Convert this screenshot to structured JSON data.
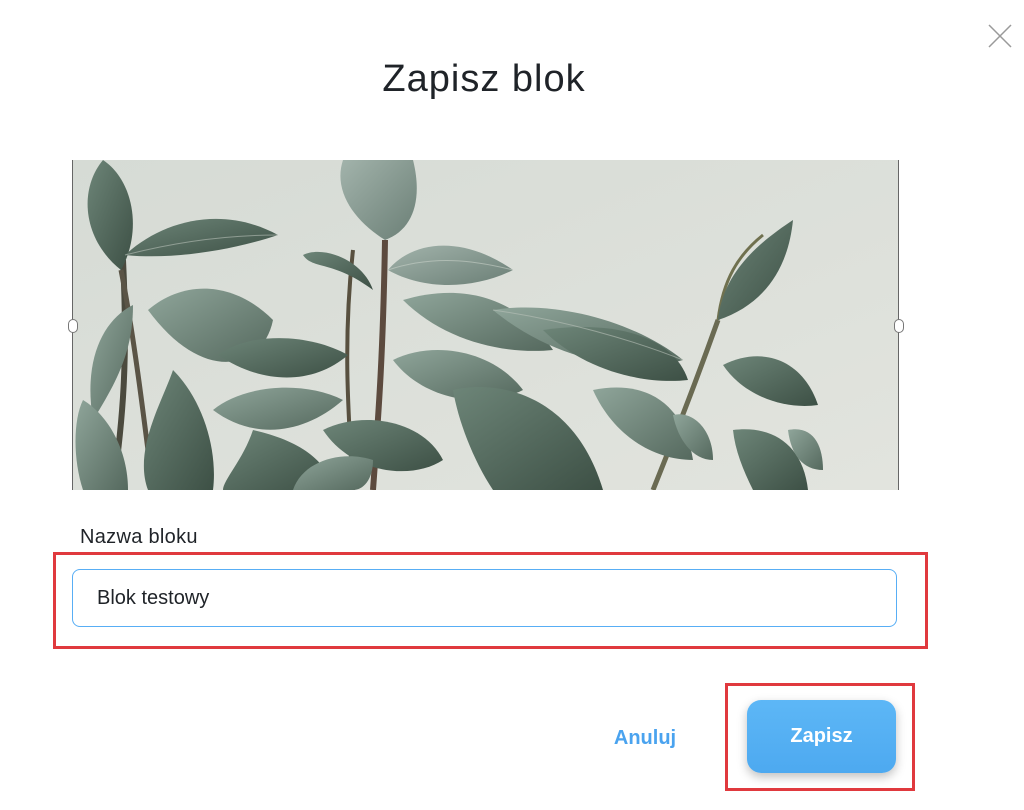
{
  "dialog": {
    "title": "Zapisz blok",
    "close_icon": "close-icon"
  },
  "preview": {
    "image_subject": "plant-leaves-image",
    "background_color": "#dcdfda"
  },
  "form": {
    "name_label": "Nazwa bloku",
    "name_value": "Blok testowy",
    "name_placeholder": ""
  },
  "actions": {
    "cancel_label": "Anuluj",
    "save_label": "Zapisz"
  },
  "colors": {
    "accent": "#4aa3ef",
    "highlight": "#e0393e",
    "input_border": "#58aef5"
  }
}
